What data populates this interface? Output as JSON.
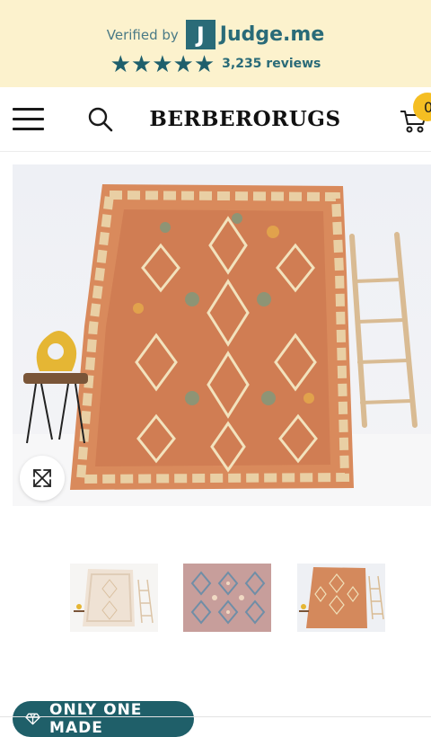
{
  "verified_banner": {
    "verified_text": "Verified by",
    "logo_letter": "J",
    "brand_name": "Judge.me",
    "rating_stars": "★★★★★",
    "star_count": 5,
    "reviews_text": "3,235 reviews",
    "colors": {
      "background": "#fcf2cd",
      "accent": "#2a6b78"
    }
  },
  "header": {
    "brand": "BERBERORUGS",
    "cart_count": "0",
    "menu_icon": "hamburger-icon",
    "search_icon": "search-icon",
    "cart_icon": "cart-icon",
    "colors": {
      "badge": "#f5be22"
    }
  },
  "gallery": {
    "zoom_icon": "expand-icon",
    "thumbnails": [
      {
        "name": "thumbnail-1"
      },
      {
        "name": "thumbnail-2"
      },
      {
        "name": "thumbnail-3"
      }
    ]
  },
  "product": {
    "badge_label": "ONLY ONE MADE",
    "badge_icon": "diamond-icon",
    "colors": {
      "badge": "#1f5f69"
    }
  }
}
